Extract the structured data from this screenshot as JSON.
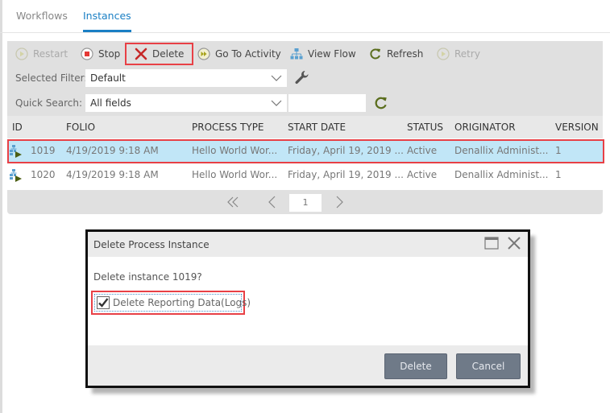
{
  "tabs": [
    {
      "label": "Workflows",
      "active": false
    },
    {
      "label": "Instances",
      "active": true
    }
  ],
  "toolbar": {
    "restart": {
      "label": "Restart",
      "icon": "play-circle-icon",
      "enabled": false
    },
    "stop": {
      "label": "Stop",
      "icon": "stop-circle-icon",
      "enabled": true
    },
    "delete": {
      "label": "Delete",
      "icon": "x-icon",
      "enabled": true,
      "highlighted": true
    },
    "goto_activity": {
      "label": "Go To Activity",
      "icon": "fast-forward-circle-icon",
      "enabled": true
    },
    "view_flow": {
      "label": "View Flow",
      "icon": "flow-chart-icon",
      "enabled": true
    },
    "refresh": {
      "label": "Refresh",
      "icon": "refresh-icon",
      "enabled": true
    },
    "retry": {
      "label": "Retry",
      "icon": "play-circle-icon",
      "enabled": false
    }
  },
  "filters": {
    "selected_filter_label": "Selected Filter:",
    "selected_filter_value": "Default",
    "quick_search_label": "Quick Search:",
    "quick_search_field": "All fields",
    "quick_search_value": ""
  },
  "grid": {
    "columns": [
      "ID",
      "FOLIO",
      "PROCESS TYPE",
      "START DATE",
      "STATUS",
      "ORIGINATOR",
      "VERSION"
    ],
    "rows": [
      {
        "id": "1019",
        "folio": "4/19/2019 9:18 AM",
        "process_type": "Hello World Wor...",
        "start_date": "Friday, April 19, 2019 ...",
        "status": "Active",
        "originator": "Denallix Administ...",
        "version": "1",
        "selected": true
      },
      {
        "id": "1020",
        "folio": "4/19/2019 9:18 AM",
        "process_type": "Hello World Wor...",
        "start_date": "Friday, April 19, 2019 ...",
        "status": "Active",
        "originator": "Denallix Administ...",
        "version": "1",
        "selected": false
      }
    ]
  },
  "pager": {
    "current_page": "1"
  },
  "dialog": {
    "title": "Delete Process Instance",
    "message": "Delete instance 1019?",
    "checkbox_label": "Delete Reporting Data(Logs)",
    "checkbox_checked": true,
    "delete_label": "Delete",
    "cancel_label": "Cancel"
  },
  "colors": {
    "accent": "#1a7fc4",
    "highlight_border": "#e84046",
    "selected_row": "#c1e6f7",
    "dialog_button": "#6f7a88"
  }
}
